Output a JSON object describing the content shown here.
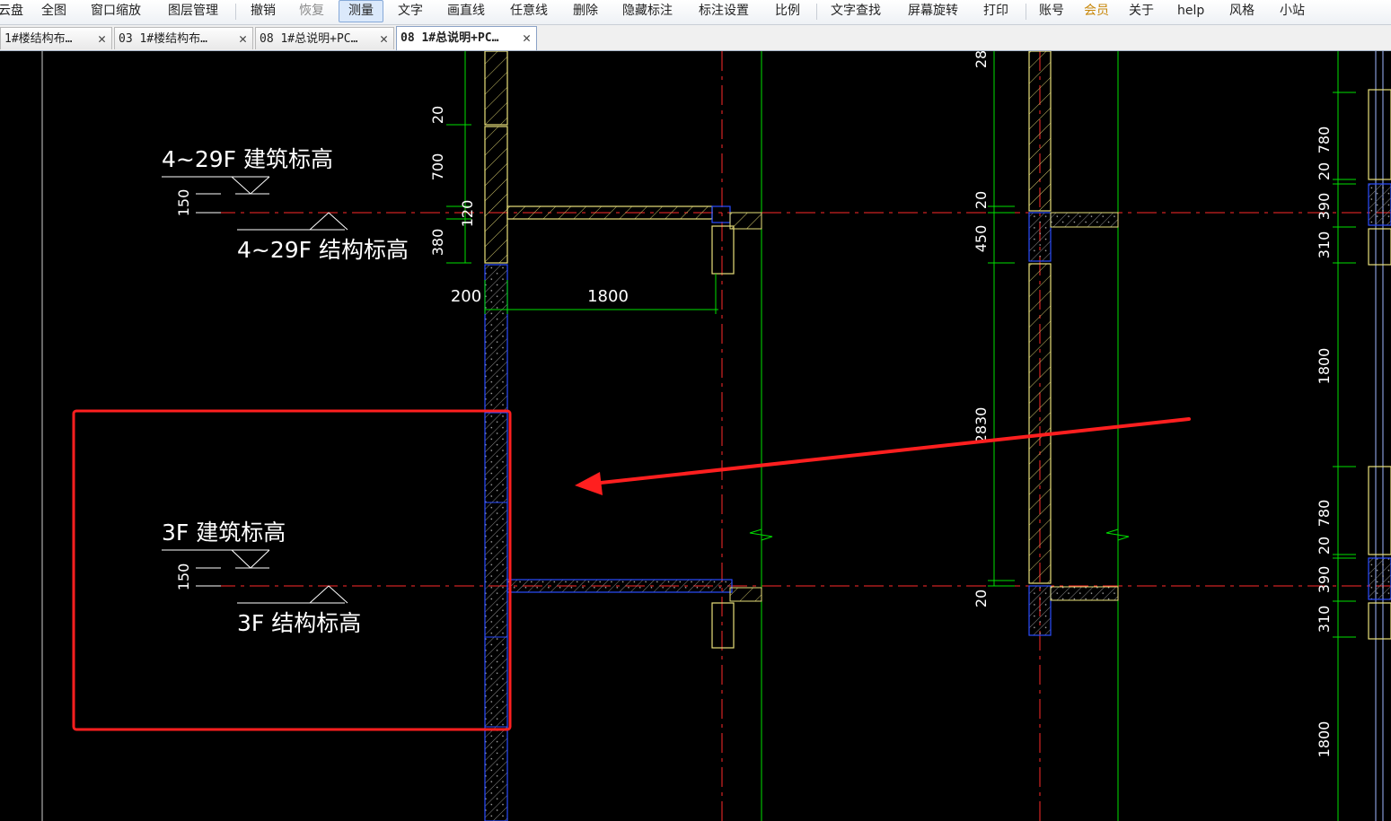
{
  "menu": {
    "items": [
      "云盘",
      "全图",
      "窗口缩放",
      "图层管理",
      "撤销",
      "恢复",
      "测量",
      "文字",
      "画直线",
      "任意线",
      "删除",
      "隐藏标注",
      "标注设置",
      "比例",
      "文字查找",
      "屏幕旋转",
      "打印",
      "账号",
      "会员",
      "关于",
      "help",
      "风格",
      "小站"
    ],
    "active": "测量"
  },
  "tabs": [
    {
      "label": "1#楼结构布…"
    },
    {
      "label": "03 1#楼结构布…"
    },
    {
      "label": "08 1#总说明+PC…"
    },
    {
      "label": "08 1#总说明+PC…"
    }
  ],
  "drawing": {
    "level_upper_arch": "4~29F 建筑标高",
    "level_upper_struct": "4~29F 结构标高",
    "level_lower_arch": "3F 建筑标高",
    "level_lower_struct": "3F 结构标高",
    "offset_upper": "150",
    "offset_lower": "150",
    "dims_left": [
      "20",
      "700",
      "120",
      "380"
    ],
    "dim_wall": "200",
    "dim_span": "1800",
    "dims_mid": [
      "28",
      "20",
      "450",
      "2830",
      "20"
    ],
    "dims_right_upper": [
      "780",
      "20",
      "390",
      "310"
    ],
    "dim_right_mid": "1800",
    "dims_right_lower": [
      "780",
      "20",
      "390",
      "310"
    ],
    "dim_right_bottom": "1800"
  },
  "colors": {
    "background": "#000000",
    "axis_red": "#ff2a2a",
    "dimension_green": "#00e000",
    "wall_yellow": "#e8e07a",
    "precast_blue": "#2a4cff",
    "annotation_red": "#ff1f1f"
  }
}
